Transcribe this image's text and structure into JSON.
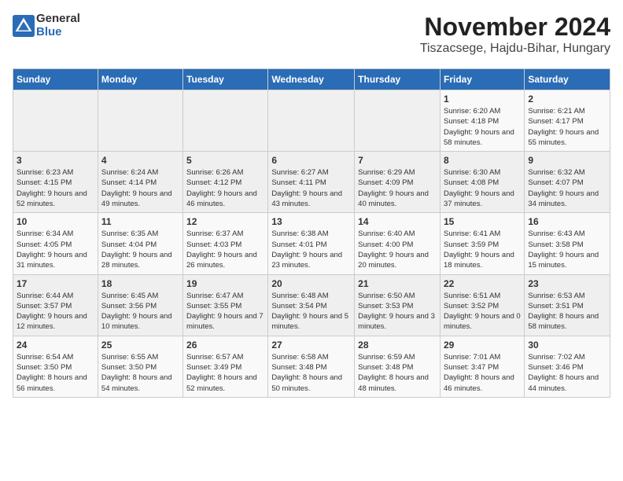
{
  "header": {
    "logo_general": "General",
    "logo_blue": "Blue",
    "month_year": "November 2024",
    "location": "Tiszacsege, Hajdu-Bihar, Hungary"
  },
  "weekdays": [
    "Sunday",
    "Monday",
    "Tuesday",
    "Wednesday",
    "Thursday",
    "Friday",
    "Saturday"
  ],
  "weeks": [
    [
      {
        "day": "",
        "info": ""
      },
      {
        "day": "",
        "info": ""
      },
      {
        "day": "",
        "info": ""
      },
      {
        "day": "",
        "info": ""
      },
      {
        "day": "",
        "info": ""
      },
      {
        "day": "1",
        "info": "Sunrise: 6:20 AM\nSunset: 4:18 PM\nDaylight: 9 hours and 58 minutes."
      },
      {
        "day": "2",
        "info": "Sunrise: 6:21 AM\nSunset: 4:17 PM\nDaylight: 9 hours and 55 minutes."
      }
    ],
    [
      {
        "day": "3",
        "info": "Sunrise: 6:23 AM\nSunset: 4:15 PM\nDaylight: 9 hours and 52 minutes."
      },
      {
        "day": "4",
        "info": "Sunrise: 6:24 AM\nSunset: 4:14 PM\nDaylight: 9 hours and 49 minutes."
      },
      {
        "day": "5",
        "info": "Sunrise: 6:26 AM\nSunset: 4:12 PM\nDaylight: 9 hours and 46 minutes."
      },
      {
        "day": "6",
        "info": "Sunrise: 6:27 AM\nSunset: 4:11 PM\nDaylight: 9 hours and 43 minutes."
      },
      {
        "day": "7",
        "info": "Sunrise: 6:29 AM\nSunset: 4:09 PM\nDaylight: 9 hours and 40 minutes."
      },
      {
        "day": "8",
        "info": "Sunrise: 6:30 AM\nSunset: 4:08 PM\nDaylight: 9 hours and 37 minutes."
      },
      {
        "day": "9",
        "info": "Sunrise: 6:32 AM\nSunset: 4:07 PM\nDaylight: 9 hours and 34 minutes."
      }
    ],
    [
      {
        "day": "10",
        "info": "Sunrise: 6:34 AM\nSunset: 4:05 PM\nDaylight: 9 hours and 31 minutes."
      },
      {
        "day": "11",
        "info": "Sunrise: 6:35 AM\nSunset: 4:04 PM\nDaylight: 9 hours and 28 minutes."
      },
      {
        "day": "12",
        "info": "Sunrise: 6:37 AM\nSunset: 4:03 PM\nDaylight: 9 hours and 26 minutes."
      },
      {
        "day": "13",
        "info": "Sunrise: 6:38 AM\nSunset: 4:01 PM\nDaylight: 9 hours and 23 minutes."
      },
      {
        "day": "14",
        "info": "Sunrise: 6:40 AM\nSunset: 4:00 PM\nDaylight: 9 hours and 20 minutes."
      },
      {
        "day": "15",
        "info": "Sunrise: 6:41 AM\nSunset: 3:59 PM\nDaylight: 9 hours and 18 minutes."
      },
      {
        "day": "16",
        "info": "Sunrise: 6:43 AM\nSunset: 3:58 PM\nDaylight: 9 hours and 15 minutes."
      }
    ],
    [
      {
        "day": "17",
        "info": "Sunrise: 6:44 AM\nSunset: 3:57 PM\nDaylight: 9 hours and 12 minutes."
      },
      {
        "day": "18",
        "info": "Sunrise: 6:45 AM\nSunset: 3:56 PM\nDaylight: 9 hours and 10 minutes."
      },
      {
        "day": "19",
        "info": "Sunrise: 6:47 AM\nSunset: 3:55 PM\nDaylight: 9 hours and 7 minutes."
      },
      {
        "day": "20",
        "info": "Sunrise: 6:48 AM\nSunset: 3:54 PM\nDaylight: 9 hours and 5 minutes."
      },
      {
        "day": "21",
        "info": "Sunrise: 6:50 AM\nSunset: 3:53 PM\nDaylight: 9 hours and 3 minutes."
      },
      {
        "day": "22",
        "info": "Sunrise: 6:51 AM\nSunset: 3:52 PM\nDaylight: 9 hours and 0 minutes."
      },
      {
        "day": "23",
        "info": "Sunrise: 6:53 AM\nSunset: 3:51 PM\nDaylight: 8 hours and 58 minutes."
      }
    ],
    [
      {
        "day": "24",
        "info": "Sunrise: 6:54 AM\nSunset: 3:50 PM\nDaylight: 8 hours and 56 minutes."
      },
      {
        "day": "25",
        "info": "Sunrise: 6:55 AM\nSunset: 3:50 PM\nDaylight: 8 hours and 54 minutes."
      },
      {
        "day": "26",
        "info": "Sunrise: 6:57 AM\nSunset: 3:49 PM\nDaylight: 8 hours and 52 minutes."
      },
      {
        "day": "27",
        "info": "Sunrise: 6:58 AM\nSunset: 3:48 PM\nDaylight: 8 hours and 50 minutes."
      },
      {
        "day": "28",
        "info": "Sunrise: 6:59 AM\nSunset: 3:48 PM\nDaylight: 8 hours and 48 minutes."
      },
      {
        "day": "29",
        "info": "Sunrise: 7:01 AM\nSunset: 3:47 PM\nDaylight: 8 hours and 46 minutes."
      },
      {
        "day": "30",
        "info": "Sunrise: 7:02 AM\nSunset: 3:46 PM\nDaylight: 8 hours and 44 minutes."
      }
    ]
  ]
}
